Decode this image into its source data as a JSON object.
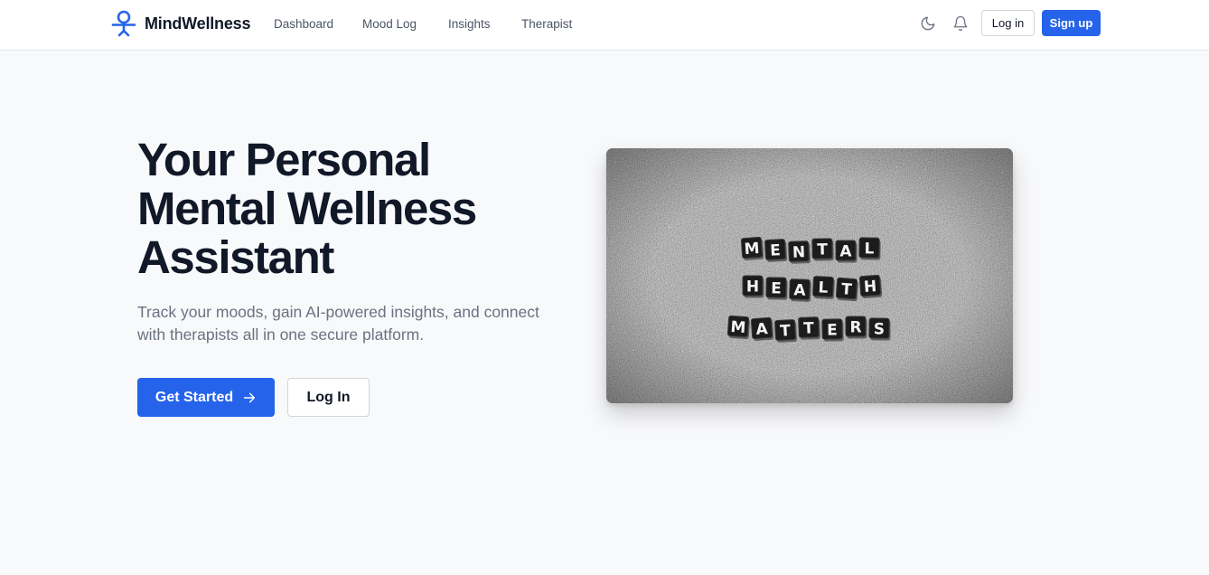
{
  "brand": {
    "name": "MindWellness",
    "icon": "meditation-person-icon"
  },
  "nav": {
    "links": [
      {
        "label": "Dashboard"
      },
      {
        "label": "Mood Log"
      },
      {
        "label": "Insights"
      },
      {
        "label": "Therapist"
      }
    ],
    "theme_icon": "moon-icon",
    "notifications_icon": "bell-icon",
    "login_label": "Log in",
    "signup_label": "Sign up"
  },
  "hero": {
    "title_lines": [
      "Your Personal",
      "Mental Wellness",
      "Assistant"
    ],
    "subtitle": "Track your moods, gain AI-powered insights, and connect with therapists all in one secure platform.",
    "primary_cta": "Get Started",
    "primary_cta_icon": "arrow-right-icon",
    "secondary_cta": "Log In",
    "image": {
      "tiles": [
        "MENTAL",
        "HEALTH",
        "MATTERS"
      ]
    }
  },
  "colors": {
    "accent": "#2563eb",
    "text": "#111827",
    "muted": "#6b7280",
    "background": "#f8f9fb"
  }
}
